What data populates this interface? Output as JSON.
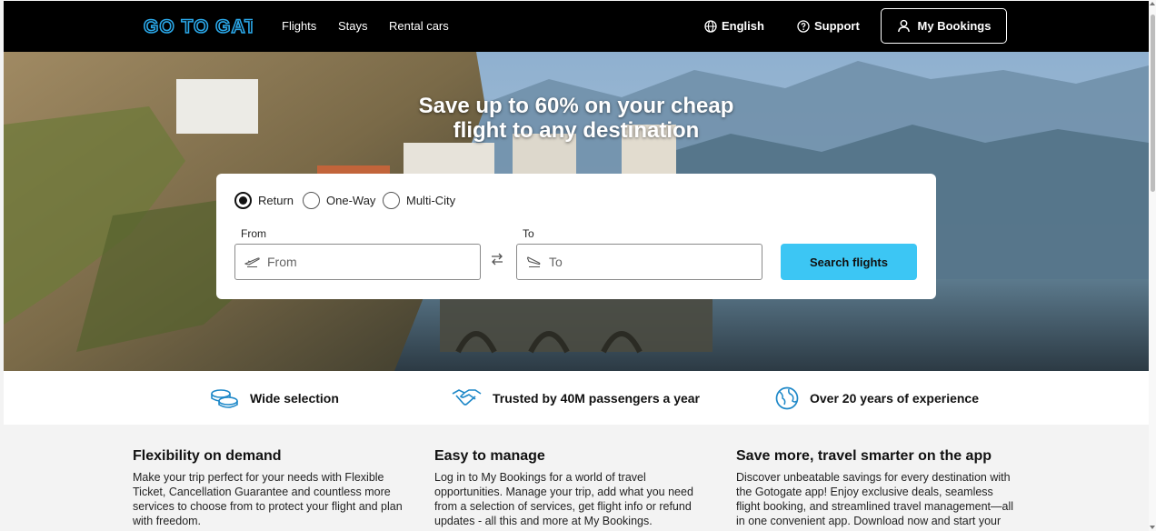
{
  "header": {
    "logo_text": "GOTOGATE",
    "nav": [
      "Flights",
      "Stays",
      "Rental cars"
    ],
    "language_label": "English",
    "support_label": "Support",
    "my_bookings_label": "My Bookings"
  },
  "hero": {
    "title_line1": "Save up to 60% on your cheap",
    "title_line2": "flight to any destination"
  },
  "search": {
    "trip_types": [
      "Return",
      "One-Way",
      "Multi-City"
    ],
    "selected_trip_type": "Return",
    "from_label": "From",
    "from_placeholder": "From",
    "from_value": "",
    "to_label": "To",
    "to_placeholder": "To",
    "to_value": "",
    "button_label": "Search flights"
  },
  "features": [
    {
      "label": "Wide selection",
      "icon": "coins-icon"
    },
    {
      "label": "Trusted by 40M passengers a year",
      "icon": "handshake-icon"
    },
    {
      "label": "Over 20 years of experience",
      "icon": "globe-icon"
    }
  ],
  "info": [
    {
      "title": "Flexibility on demand",
      "body": "Make your trip perfect for your needs with Flexible Ticket, Cancellation Guarantee and countless more services to choose from to protect your flight and plan with freedom."
    },
    {
      "title": "Easy to manage",
      "body": "Log in to My Bookings for a world of travel opportunities. Manage your trip, add what you need from a selection of services, get flight info or refund updates - all this and more at My Bookings."
    },
    {
      "title": "Save more, travel smarter on the app",
      "body": "Discover unbeatable savings for every destination with the Gotogate app! Enjoy exclusive deals, seamless flight booking, and streamlined travel management—all in one convenient app. Download now and start your"
    }
  ],
  "colors": {
    "header_bg": "#000000",
    "logo_blue": "#2aa7e8",
    "accent_cyan": "#3cc6f4",
    "icon_blue": "#1e88c8"
  }
}
